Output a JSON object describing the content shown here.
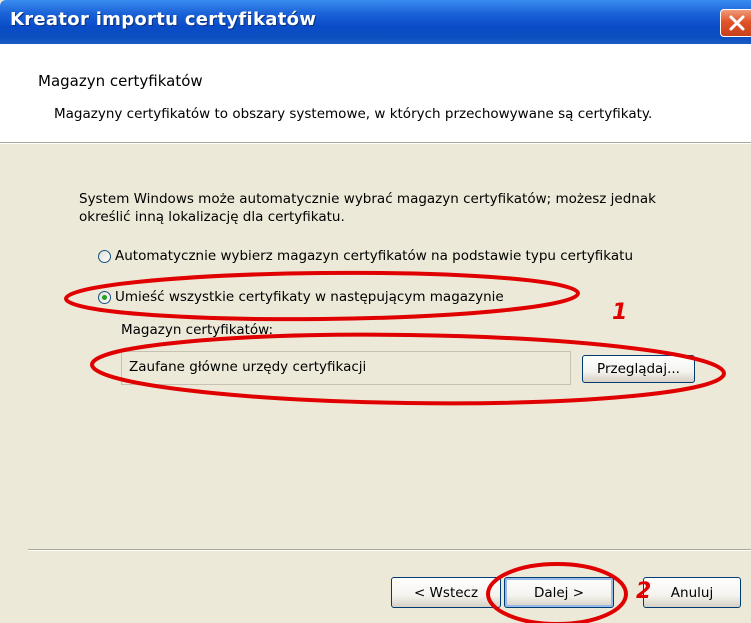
{
  "window": {
    "title": "Kreator importu certyfikatów",
    "close_icon": "close-icon"
  },
  "header": {
    "title": "Magazyn certyfikatów",
    "description": "Magazyny certyfikatów to obszary systemowe, w których przechowywane są certyfikaty."
  },
  "body": {
    "intro": "System Windows może automatycznie wybrać magazyn certyfikatów; możesz jednak określić inną lokalizację dla certyfikatu.",
    "radio_auto_label": "Automatycznie wybierz magazyn certyfikatów na podstawie typu certyfikatu",
    "radio_auto_checked": false,
    "radio_manual_label": "Umieść wszystkie certyfikaty w następującym magazynie",
    "radio_manual_checked": true,
    "store_label": "Magazyn certyfikatów:",
    "store_value": "Zaufane główne urzędy certyfikacji",
    "browse_label": "Przeglądaj..."
  },
  "footer": {
    "back_label": "< Wstecz",
    "next_label": "Dalej >",
    "cancel_label": "Anuluj"
  },
  "annotations": {
    "marker_1": "1",
    "marker_2": "2",
    "color": "#e00000"
  },
  "colors": {
    "titlebar": "#0a4cc8",
    "dialog_bg": "#ece9d8",
    "radio_dot": "#21a121"
  }
}
